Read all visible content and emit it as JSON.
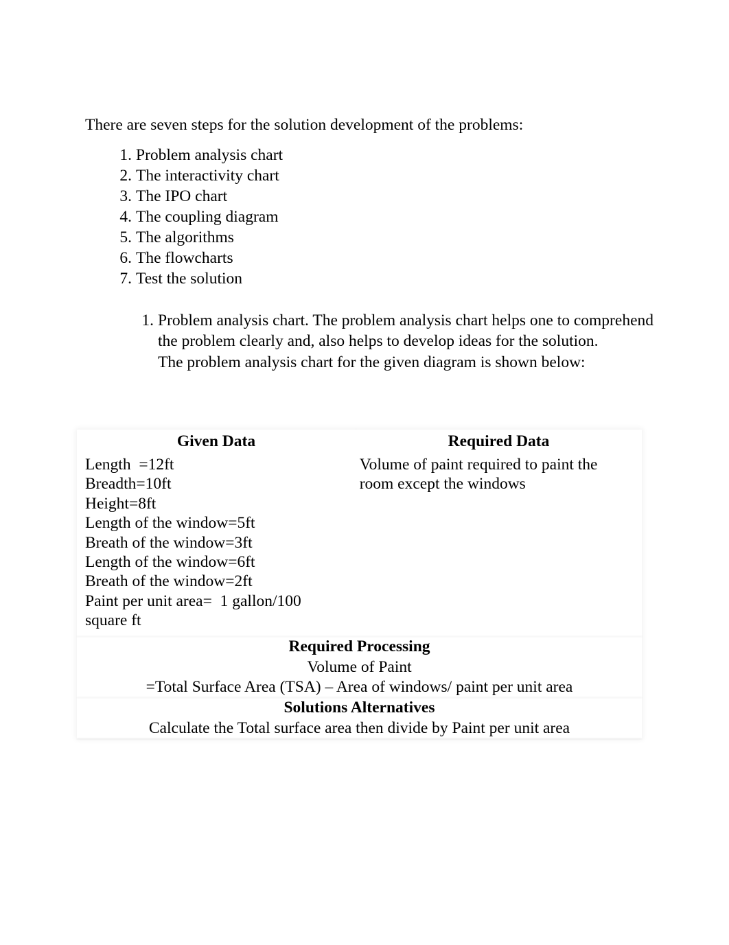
{
  "document": {
    "intro": "There are seven steps for the solution development of the problems:",
    "steps": [
      {
        "num": "1.",
        "label": "Problem analysis chart"
      },
      {
        "num": "2.",
        "label": "The interactivity chart"
      },
      {
        "num": "3.",
        "label": "The IPO chart"
      },
      {
        "num": "4.",
        "label": "The coupling diagram"
      },
      {
        "num": "5.",
        "label": "The algorithms"
      },
      {
        "num": "6.",
        "label": "The flowcharts"
      },
      {
        "num": "7.",
        "label": "Test the solution"
      }
    ],
    "detail": {
      "num": "1.",
      "paragraph": "Problem analysis chart. The problem analysis chart helps one to comprehend the problem clearly and, also helps to develop ideas for the solution.",
      "followup": "The problem analysis chart for the given diagram is shown below:"
    },
    "table": {
      "headers": {
        "given": "Given Data",
        "required": "Required Data"
      },
      "given_data_lines": [
        "Length  =12ft",
        "Breadth=10ft",
        "Height=8ft",
        "Length of the window=5ft",
        "Breath of the window=3ft",
        "Length of the window=6ft",
        "Breath of the window=2ft",
        "Paint per unit area=  1 gallon/100",
        "square ft"
      ],
      "required_data_lines": [
        "Volume of paint required to paint the",
        "room except the windows"
      ],
      "required_processing": {
        "title": "Required Processing",
        "lines": [
          "Volume of Paint",
          "=Total Surface Area (TSA) – Area of windows/ paint per unit area"
        ]
      },
      "solutions_alternatives": {
        "title": "Solutions Alternatives",
        "lines": [
          "Calculate the Total surface area then divide by Paint per unit area"
        ]
      }
    }
  }
}
